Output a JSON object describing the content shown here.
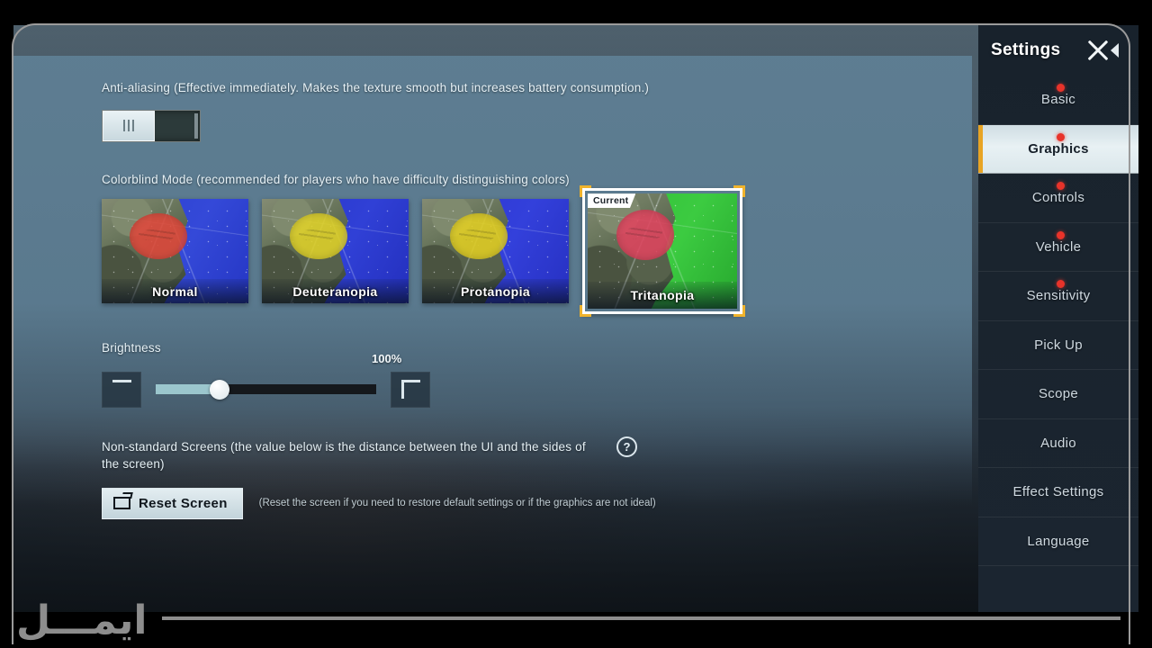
{
  "panel": {
    "antialiasing": {
      "label": "Anti-aliasing (Effective immediately. Makes the texture smooth but increases battery consumption.)",
      "toggle_state": "off"
    },
    "colorblind": {
      "label": "Colorblind Mode (recommended for players who have difficulty distinguishing colors)",
      "current_badge": "Current",
      "options": [
        {
          "label": "Normal",
          "blob_color": "#e0493c",
          "sea_color": "#2b3fd0",
          "selected": false
        },
        {
          "label": "Deuteranopia",
          "blob_color": "#e0d22a",
          "sea_color": "#2735c9",
          "selected": false
        },
        {
          "label": "Protanopia",
          "blob_color": "#e2cf24",
          "sea_color": "#2b34cf",
          "selected": false
        },
        {
          "label": "Tritanopia",
          "blob_color": "#e0455f",
          "sea_color": "#2fbe36",
          "selected": true
        }
      ]
    },
    "brightness": {
      "label": "Brightness",
      "value": "100%",
      "minus_label": "−",
      "plus_label": "+"
    },
    "nonstandard": {
      "label": "Non-standard Screens (the value below is the distance between the UI and the sides of the screen)",
      "help_icon": "question-mark-icon",
      "reset_button": "Reset Screen",
      "reset_hint": "(Reset the screen if you need to restore default settings or if the graphics are not ideal)"
    }
  },
  "sidebar": {
    "title": "Settings",
    "close_icon": "close-icon",
    "collapse_icon": "collapse-left-icon",
    "items": [
      {
        "label": "Basic",
        "badge": true,
        "active": false
      },
      {
        "label": "Graphics",
        "badge": true,
        "active": true
      },
      {
        "label": "Controls",
        "badge": true,
        "active": false
      },
      {
        "label": "Vehicle",
        "badge": true,
        "active": false
      },
      {
        "label": "Sensitivity",
        "badge": true,
        "active": false
      },
      {
        "label": "Pick Up",
        "badge": false,
        "active": false
      },
      {
        "label": "Scope",
        "badge": false,
        "active": false
      },
      {
        "label": "Audio",
        "badge": false,
        "active": false
      },
      {
        "label": "Effect Settings",
        "badge": false,
        "active": false
      },
      {
        "label": "Language",
        "badge": false,
        "active": false
      }
    ]
  },
  "watermark": {
    "text": "ایمـــل"
  },
  "colors": {
    "accent_gold": "#e8a424",
    "badge_red": "#e8332a",
    "panel_blue": "#5e7e93",
    "slider_fill": "#9bc6cd"
  }
}
